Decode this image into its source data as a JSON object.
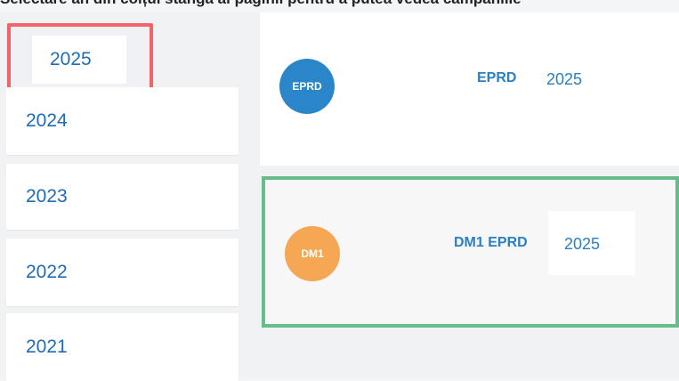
{
  "header": {
    "instruction_text": "Selectare an din colțul stânga al paginii pentru a putea vedea campaniile"
  },
  "sidebar": {
    "years": [
      {
        "label": "2025",
        "selected": true
      },
      {
        "label": "2024",
        "selected": false
      },
      {
        "label": "2023",
        "selected": false
      },
      {
        "label": "2022",
        "selected": false
      },
      {
        "label": "2021",
        "selected": false
      }
    ]
  },
  "campaigns": [
    {
      "badge": "EPRD",
      "title": "EPRD",
      "year": "2025",
      "badge_color": "#2a86c8"
    },
    {
      "badge": "DM1",
      "title": "DM1 EPRD",
      "year": "2025",
      "badge_color": "#f6a754",
      "highlighted": true
    }
  ],
  "colors": {
    "accent": "#1f6bb8",
    "highlight_red": "#f0646a",
    "highlight_green": "#66bd8a"
  }
}
